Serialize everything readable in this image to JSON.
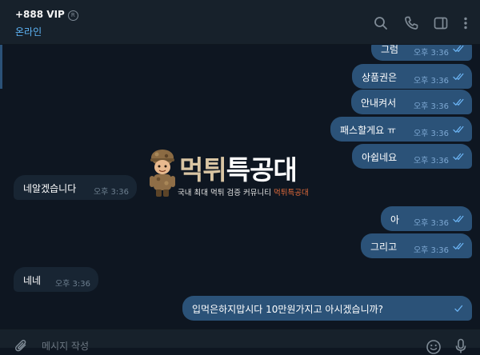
{
  "header": {
    "title": "+888 VIP",
    "verified_mark": "R",
    "status": "온라인",
    "icons": [
      "search-icon",
      "phone-icon",
      "sidebar-toggle-icon",
      "more-vertical-icon"
    ]
  },
  "messages": [
    {
      "direction": "out",
      "text": "그럼",
      "time": "오후 3:36",
      "read": true
    },
    {
      "direction": "out",
      "text": "상품권은",
      "time": "오후 3:36",
      "read": true
    },
    {
      "direction": "out",
      "text": "안내켜서",
      "time": "오후 3:36",
      "read": true
    },
    {
      "direction": "out",
      "text": "패스할게요 ㅠ",
      "time": "오후 3:36",
      "read": true
    },
    {
      "direction": "out",
      "text": "아쉽네요",
      "time": "오후 3:36",
      "read": true
    },
    {
      "direction": "in",
      "text": "네알겠습니다",
      "time": "오후 3:36"
    },
    {
      "direction": "out",
      "text": "아",
      "time": "오후 3:36",
      "read": true
    },
    {
      "direction": "out",
      "text": "그리고",
      "time": "오후 3:36",
      "read": true
    },
    {
      "direction": "in",
      "text": "네네",
      "time": "오후 3:36"
    },
    {
      "direction": "out",
      "text": "입먹은하지맙시다 10만원가지고 아시겠습니까?",
      "time": "",
      "read": true
    }
  ],
  "watermark": {
    "title_part1": "먹튀",
    "title_part2": "특공대",
    "subtitle": "국내 최대 먹튀 검증 커뮤니티",
    "subtitle_accent": "먹튀특공대"
  },
  "composer": {
    "placeholder": "메시지 작성",
    "value": ""
  },
  "colors": {
    "background": "#0e1621",
    "header": "#17212b",
    "outgoing_bubble": "#2b5278",
    "incoming_bubble": "#182533",
    "status_blue": "#5eb5f7"
  }
}
